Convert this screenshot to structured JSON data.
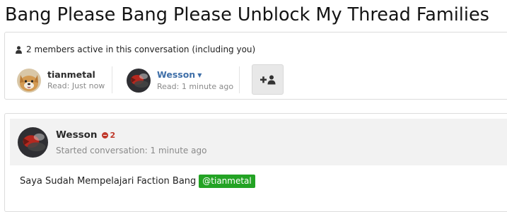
{
  "thread": {
    "title": "Bang Please Bang Please Unblock My Thread Families"
  },
  "members": {
    "header": "2 members active in this conversation (including you)",
    "header_icon": "user-icon",
    "list": [
      {
        "name": "tianmetal",
        "status": "Read: Just now",
        "avatar": "dog-avatar"
      },
      {
        "name": "Wesson",
        "status": "Read: 1 minute ago",
        "avatar": "wesson-avatar",
        "has_dropdown": true
      }
    ],
    "invite_icon": "add-user-icon"
  },
  "message": {
    "author": "Wesson",
    "reputation": "2",
    "started": "Started conversation: 1 minute ago",
    "body": "Saya Sudah Mempelajari Faction Bang",
    "mention": "@tianmetal"
  },
  "colors": {
    "link_blue": "#3f6fa8",
    "mention_green": "#23a324",
    "reputation_red": "#c0392b",
    "header_gray": "#f2f2f2"
  }
}
